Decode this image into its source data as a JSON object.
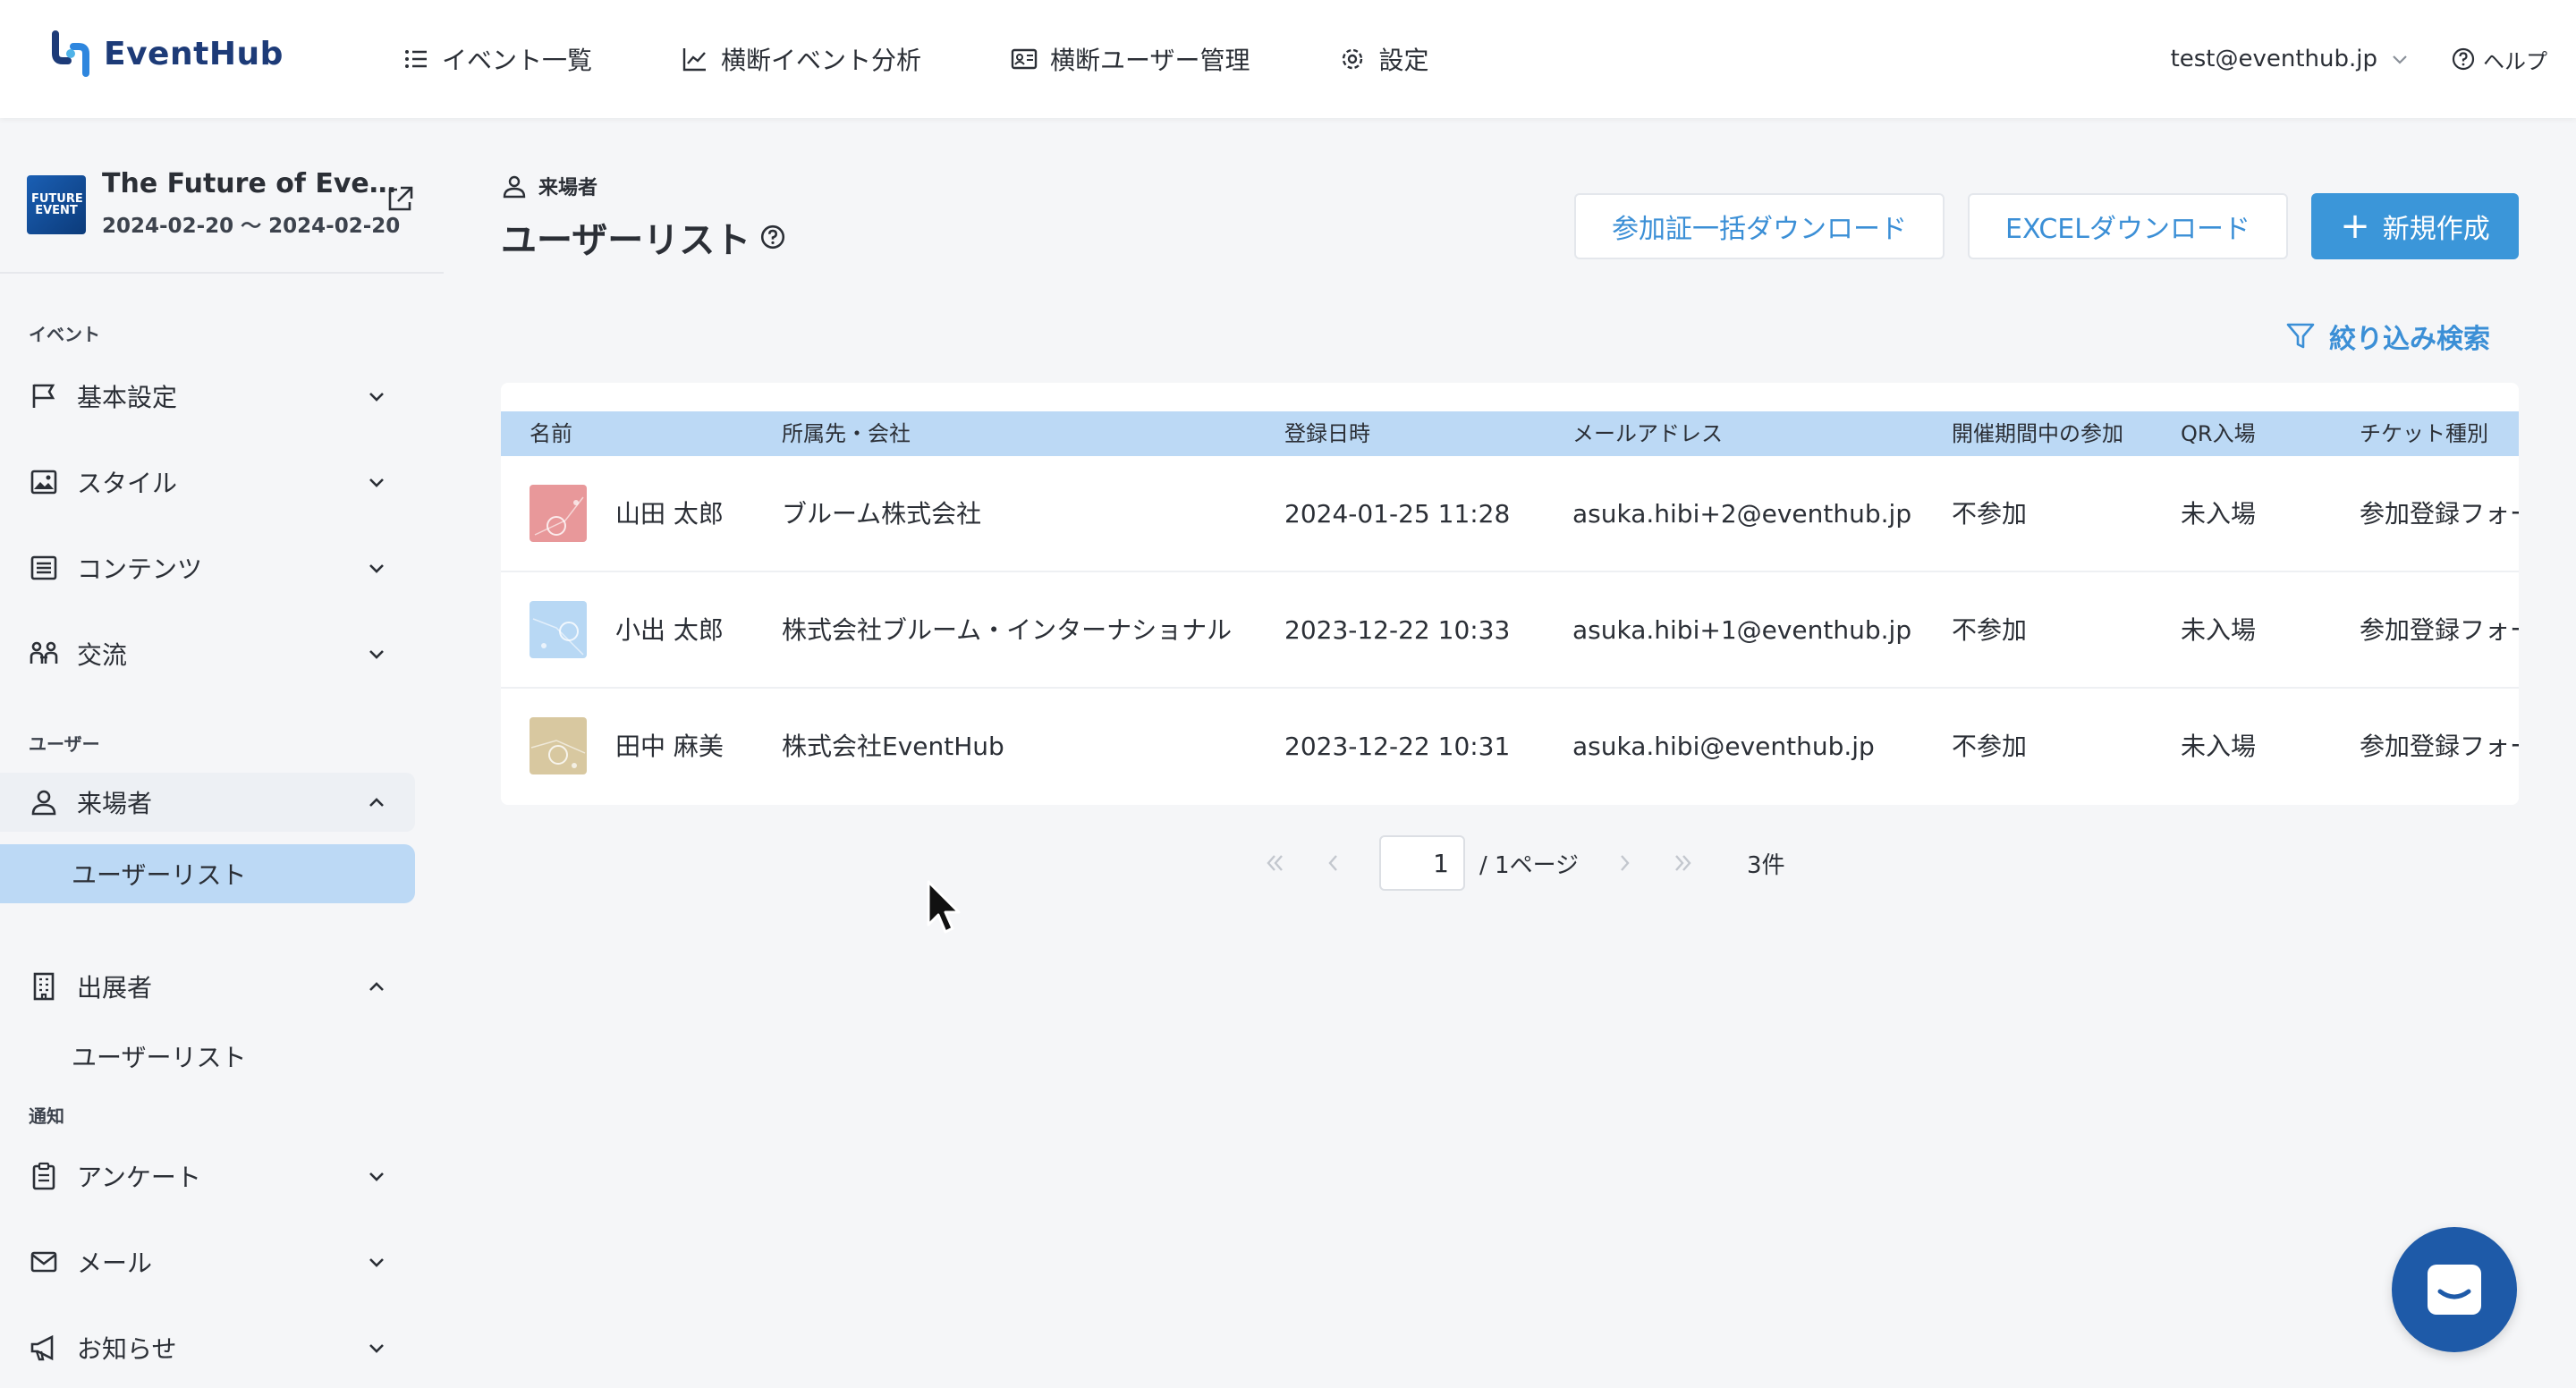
{
  "app": {
    "logo_text": "EventHub"
  },
  "topnav": {
    "items": [
      {
        "label": "イベント一覧"
      },
      {
        "label": "横断イベント分析"
      },
      {
        "label": "横断ユーザー管理"
      },
      {
        "label": "設定"
      }
    ],
    "user_email": "test@eventhub.jp",
    "help_label": "ヘルプ"
  },
  "sidebar": {
    "event": {
      "title": "The Future of Eve…",
      "dates": "2024-02-20 〜 2024-02-20",
      "thumb_text": "FUTURE EVENT"
    },
    "sections": {
      "event": "イベント",
      "user": "ユーザー",
      "notice": "通知"
    },
    "items": {
      "basic": "基本設定",
      "style": "スタイル",
      "contents": "コンテンツ",
      "exchange": "交流",
      "visitors": "来場者",
      "visitors_userlist": "ユーザーリスト",
      "exhibitors": "出展者",
      "exhibitors_userlist": "ユーザーリスト",
      "survey": "アンケート",
      "mail": "メール",
      "news": "お知らせ"
    }
  },
  "main": {
    "breadcrumb": "来場者",
    "title": "ユーザーリスト",
    "buttons": {
      "bulk_download": "参加証一括ダウンロード",
      "excel_download": "EXCELダウンロード",
      "create": "新規作成"
    },
    "filter_label": "絞り込み検索",
    "table": {
      "headers": [
        "名前",
        "所属先・会社",
        "登録日時",
        "メールアドレス",
        "開催期間中の参加",
        "QR入場",
        "チケット種別"
      ],
      "rows": [
        {
          "name": "山田 太郎",
          "company": "ブルーム株式会社",
          "registered": "2024-01-25 11:28",
          "email": "asuka.hibi+2@eventhub.jp",
          "participation": "不参加",
          "qr": "未入場",
          "ticket": "参加登録フォー",
          "avatar_color": "#e8989a"
        },
        {
          "name": "小出 太郎",
          "company": "株式会社ブルーム・インターナショナル",
          "registered": "2023-12-22 10:33",
          "email": "asuka.hibi+1@eventhub.jp",
          "participation": "不参加",
          "qr": "未入場",
          "ticket": "参加登録フォー",
          "avatar_color": "#b8d8f4"
        },
        {
          "name": "田中 麻美",
          "company": "株式会社EventHub",
          "registered": "2023-12-22 10:31",
          "email": "asuka.hibi@eventhub.jp",
          "participation": "不参加",
          "qr": "未入場",
          "ticket": "参加登録フォー",
          "avatar_color": "#d8c8a0"
        }
      ]
    },
    "pagination": {
      "current_page": "1",
      "total_pages": "/ 1ページ",
      "count": "3件"
    }
  },
  "colors": {
    "accent": "#3b96d9",
    "header_row": "#bcd9f5",
    "chat_button": "#1e5aa8"
  }
}
